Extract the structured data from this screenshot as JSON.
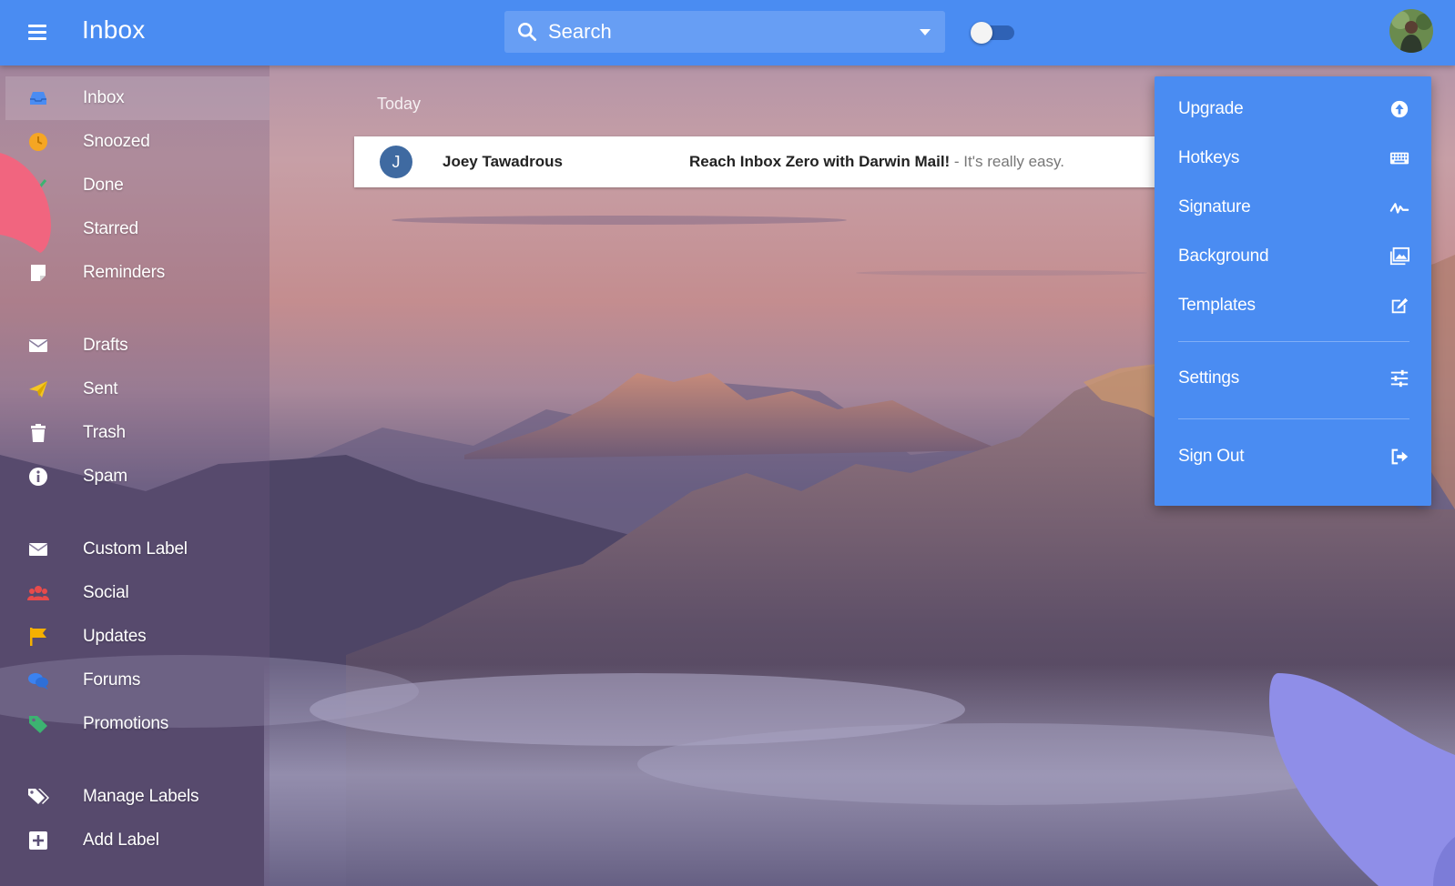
{
  "app": {
    "title": "Inbox"
  },
  "search": {
    "placeholder": "Search"
  },
  "theme": {
    "accent": "#4a8cf2"
  },
  "sidebar": {
    "groups": [
      [
        {
          "label": "Inbox",
          "icon": "inbox-icon",
          "color": "#4a8cf2",
          "active": true
        },
        {
          "label": "Snoozed",
          "icon": "clock-icon",
          "color": "#f5a623"
        },
        {
          "label": "Done",
          "icon": "check-icon",
          "color": "#3cb371"
        },
        {
          "label": "Starred",
          "icon": "star-icon",
          "color": "#f5c623"
        },
        {
          "label": "Reminders",
          "icon": "reminder-icon",
          "color": "#ffffff"
        }
      ],
      [
        {
          "label": "Drafts",
          "icon": "envelope-icon",
          "color": "#ffffff"
        },
        {
          "label": "Sent",
          "icon": "send-icon",
          "color": "#f5c623"
        },
        {
          "label": "Trash",
          "icon": "trash-icon",
          "color": "#ffffff"
        },
        {
          "label": "Spam",
          "icon": "info-icon",
          "color": "#ffffff"
        }
      ],
      [
        {
          "label": "Custom Label",
          "icon": "envelope-icon",
          "color": "#ffffff"
        },
        {
          "label": "Social",
          "icon": "people-icon",
          "color": "#e84b4b"
        },
        {
          "label": "Updates",
          "icon": "flag-icon",
          "color": "#f5b000"
        },
        {
          "label": "Forums",
          "icon": "chat-icon",
          "color": "#3b82f0"
        },
        {
          "label": "Promotions",
          "icon": "tag-icon",
          "color": "#3cb371"
        }
      ],
      [
        {
          "label": "Manage Labels",
          "icon": "tags-icon",
          "color": "#ffffff"
        },
        {
          "label": "Add Label",
          "icon": "plus-box-icon",
          "color": "#ffffff"
        }
      ]
    ]
  },
  "mail": {
    "section": "Today",
    "rows": [
      {
        "avatar_letter": "J",
        "sender": "Joey Tawadrous",
        "subject": "Reach Inbox Zero with Darwin Mail!",
        "snippet": " - It's really easy."
      }
    ]
  },
  "dropdown": {
    "groups": [
      [
        {
          "label": "Upgrade",
          "icon": "upgrade-icon"
        },
        {
          "label": "Hotkeys",
          "icon": "keyboard-icon"
        },
        {
          "label": "Signature",
          "icon": "signature-icon"
        },
        {
          "label": "Background",
          "icon": "image-icon"
        },
        {
          "label": "Templates",
          "icon": "edit-icon"
        }
      ],
      [
        {
          "label": "Settings",
          "icon": "sliders-icon"
        }
      ],
      [
        {
          "label": "Sign Out",
          "icon": "sign-out-icon"
        }
      ]
    ]
  }
}
